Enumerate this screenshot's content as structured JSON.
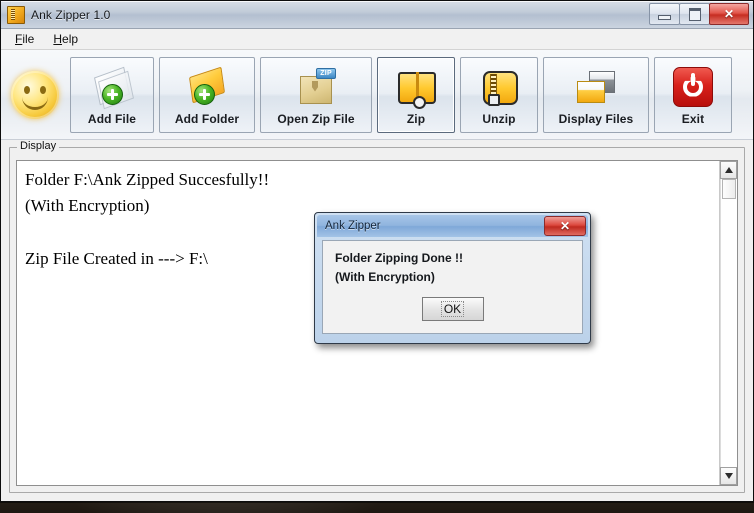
{
  "window": {
    "title": "Ank Zipper 1.0",
    "icon": "zipper-icon",
    "controls": {
      "minimize": "–",
      "maximize": "□",
      "close": "✕"
    }
  },
  "menubar": {
    "items": [
      {
        "label": "File",
        "mnemonic": "F"
      },
      {
        "label": "Help",
        "mnemonic": "H"
      }
    ]
  },
  "toolbar": {
    "logo_icon": "smiley-face-icon",
    "buttons": [
      {
        "label": "Add File",
        "icon": "file-add-icon",
        "focused": false
      },
      {
        "label": "Add Folder",
        "icon": "folder-add-icon",
        "focused": false
      },
      {
        "label": "Open Zip File",
        "icon": "zip-box-open-icon",
        "focused": false,
        "tag": "ZIP"
      },
      {
        "label": "Zip",
        "icon": "zip-folder-icon",
        "focused": true
      },
      {
        "label": "Unzip",
        "icon": "unzip-icon",
        "focused": false
      },
      {
        "label": "Display Files",
        "icon": "windows-list-icon",
        "focused": false
      },
      {
        "label": "Exit",
        "icon": "power-off-icon",
        "focused": false
      }
    ]
  },
  "display": {
    "legend": "Display",
    "text": "Folder F:\\Ank Zipped Succesfully!!\n(With Encryption)\n\nZip File Created in ---> F:\\",
    "scrollbar": {
      "up_arrow": "▲",
      "down_arrow": "▼"
    }
  },
  "dialog": {
    "title": "Ank Zipper",
    "close_label": "✕",
    "lines": [
      "Folder Zipping Done !!",
      "(With Encryption)"
    ],
    "ok_label": "OK"
  },
  "colors": {
    "accent_blue": "#8fb4de",
    "close_red": "#c02a20",
    "folder_yellow": "#ffc92f",
    "plus_green": "#4cb626",
    "window_bg": "#f0f0f0"
  }
}
